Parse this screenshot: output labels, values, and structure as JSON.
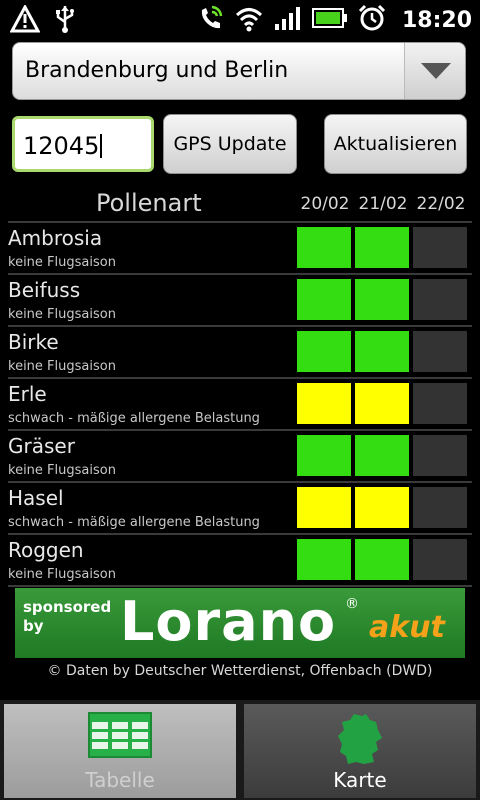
{
  "status_bar": {
    "time": "18:20",
    "icons": [
      "alert-icon",
      "usb-icon",
      "phone-signal-icon",
      "wifi-icon",
      "cell-signal-icon",
      "battery-icon",
      "alarm-icon"
    ]
  },
  "region_select": {
    "value": "Brandenburg und Berlin"
  },
  "zip_input": {
    "value": "12045"
  },
  "buttons": {
    "gps": "GPS Update",
    "refresh": "Aktualisieren"
  },
  "table": {
    "header": "Pollenart",
    "dates": [
      "20/02",
      "21/02",
      "22/02"
    ],
    "rows": [
      {
        "name": "Ambrosia",
        "desc": "keine Flugsaison",
        "levels": [
          "green",
          "green",
          "none"
        ]
      },
      {
        "name": "Beifuss",
        "desc": "keine Flugsaison",
        "levels": [
          "green",
          "green",
          "none"
        ]
      },
      {
        "name": "Birke",
        "desc": "keine Flugsaison",
        "levels": [
          "green",
          "green",
          "none"
        ]
      },
      {
        "name": "Erle",
        "desc": "schwach - mäßige allergene Belastung",
        "levels": [
          "yellow",
          "yellow",
          "none"
        ]
      },
      {
        "name": "Gräser",
        "desc": "keine Flugsaison",
        "levels": [
          "green",
          "green",
          "none"
        ]
      },
      {
        "name": "Hasel",
        "desc": "schwach - mäßige allergene Belastung",
        "levels": [
          "yellow",
          "yellow",
          "none"
        ]
      },
      {
        "name": "Roggen",
        "desc": "keine Flugsaison",
        "levels": [
          "green",
          "green",
          "none"
        ]
      }
    ]
  },
  "level_colors": {
    "green": "#33dd11",
    "yellow": "#ffff00",
    "none": "#333333"
  },
  "ad": {
    "sponsored_line1": "sponsored",
    "sponsored_line2": "by",
    "brand": "Lorano",
    "reg": "®",
    "tag": "akut"
  },
  "credits": "© Daten by Deutscher Wetterdienst, Offenbach (DWD)",
  "tabs": [
    {
      "label": "Tabelle",
      "icon": "table-icon",
      "selected": true
    },
    {
      "label": "Karte",
      "icon": "germany-map-icon",
      "selected": false
    }
  ]
}
